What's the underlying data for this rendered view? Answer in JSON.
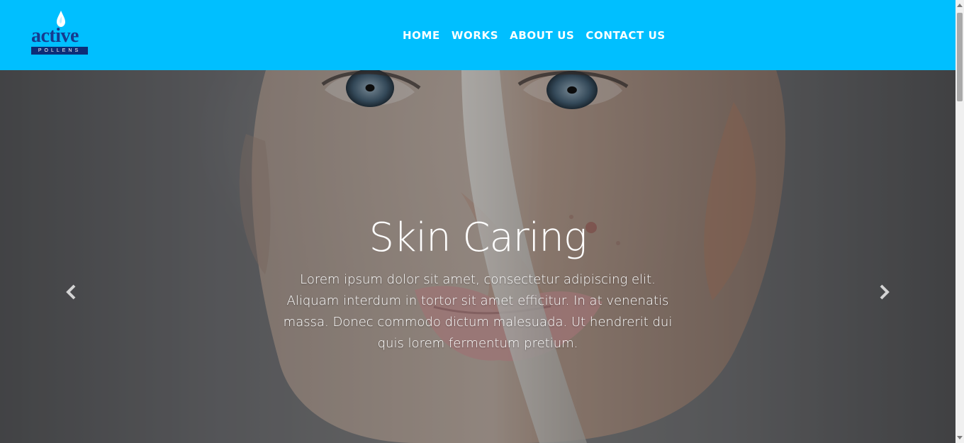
{
  "brand": {
    "word": "active",
    "sub": "POLLENS"
  },
  "nav": {
    "items": [
      {
        "label": "HOME"
      },
      {
        "label": "WORKS"
      },
      {
        "label": "ABOUT US"
      },
      {
        "label": "CONTACT US"
      }
    ]
  },
  "hero": {
    "title": "Skin Caring",
    "text": "Lorem ipsum dolor sit amet, consectetur adipiscing elit. Aliquam interdum in tortor sit amet efficitur. In at venenatis massa. Donec commodo dictum malesuada. Ut hendrerit dui quis lorem fermentum pretium."
  },
  "controls": {
    "previous_icon": "chevron-left-icon",
    "next_icon": "chevron-right-icon"
  },
  "colors": {
    "header": "#00bfff",
    "brand_blue": "#163b8f",
    "hero_text": "#ffffff"
  }
}
